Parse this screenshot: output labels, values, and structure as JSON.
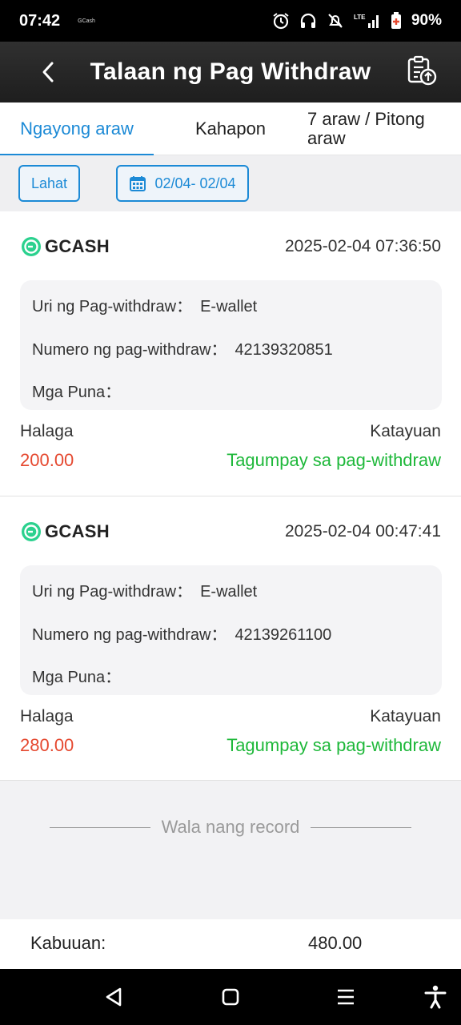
{
  "status_bar": {
    "time": "07:42",
    "app": "GCash",
    "battery": "90%",
    "icons": [
      "alarm-icon",
      "headphones-icon",
      "mute-icon",
      "lte-signal-icon",
      "battery-icon"
    ]
  },
  "header": {
    "title": "Talaan ng Pag Withdraw",
    "back_icon": "chevron-left-icon",
    "export_icon": "clipboard-upload-icon"
  },
  "tabs": [
    {
      "label": "Ngayong araw",
      "active": true
    },
    {
      "label": "Kahapon",
      "active": false
    },
    {
      "label": "7 araw / Pitong araw",
      "active": false
    }
  ],
  "filters": {
    "all_label": "Lahat",
    "date_label": "02/04- 02/04",
    "date_icon": "calendar-icon"
  },
  "records": [
    {
      "provider": "GCASH",
      "datetime": "2025-02-04 07:36:50",
      "type_label": "Uri ng Pag-withdraw：",
      "type_value": "E-wallet",
      "number_label": "Numero ng pag-withdraw：",
      "number_value": "42139320851",
      "remarks_label": "Mga Puna：",
      "remarks_value": "",
      "amount_label": "Halaga",
      "amount": "200.00",
      "status_label": "Katayuan",
      "status": "Tagumpay sa pag-withdraw"
    },
    {
      "provider": "GCASH",
      "datetime": "2025-02-04 00:47:41",
      "type_label": "Uri ng Pag-withdraw：",
      "type_value": "E-wallet",
      "number_label": "Numero ng pag-withdraw：",
      "number_value": "42139261100",
      "remarks_label": "Mga Puna：",
      "remarks_value": "",
      "amount_label": "Halaga",
      "amount": "280.00",
      "status_label": "Katayuan",
      "status": "Tagumpay sa pag-withdraw"
    }
  ],
  "no_more_text": "Wala nang record",
  "total": {
    "label": "Kabuuan:",
    "value": "480.00"
  },
  "colors": {
    "accent": "#1c8ad6",
    "amount": "#e5482f",
    "success": "#1eb83a",
    "gcash": "#2bd18e"
  },
  "nav_bar": [
    "back-triangle-icon",
    "home-square-icon",
    "recents-menu-icon",
    "accessibility-icon"
  ]
}
